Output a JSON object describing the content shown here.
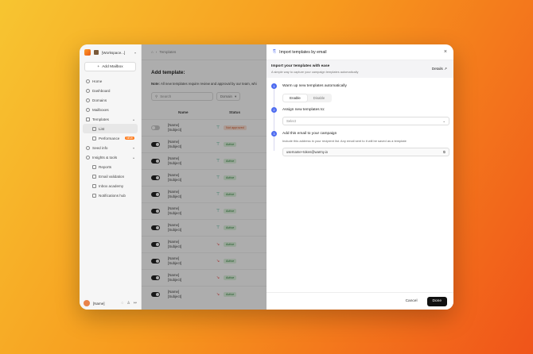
{
  "sidebar": {
    "workspace": "[Workspace...]",
    "add_mailbox": "Add Mailbox",
    "items": [
      {
        "label": "Home",
        "icon": "home-icon"
      },
      {
        "label": "Dashboard",
        "icon": "dashboard-icon"
      },
      {
        "label": "Domains",
        "icon": "globe-icon"
      },
      {
        "label": "Mailboxes",
        "icon": "mailbox-icon"
      },
      {
        "label": "Templates",
        "icon": "templates-icon"
      },
      {
        "label": "List",
        "icon": "list-icon"
      },
      {
        "label": "Performance",
        "icon": "chart-icon",
        "badge": "NEW"
      },
      {
        "label": "Seed info",
        "icon": "seed-icon"
      },
      {
        "label": "Insights & tools",
        "icon": "insights-icon"
      },
      {
        "label": "Reports",
        "icon": "report-icon"
      },
      {
        "label": "Email validation",
        "icon": "check-icon"
      },
      {
        "label": "Inbox academy",
        "icon": "academy-icon"
      },
      {
        "label": "Notifications hub",
        "icon": "bell-icon"
      }
    ],
    "user_name": "[Name]"
  },
  "main": {
    "breadcrumb_current": "Templates",
    "title": "Add template:",
    "note_bold": "Note:",
    "note_text": "All new templates require review and approval by our team, whi",
    "search_placeholder": "Search",
    "domain_filter": "Domain",
    "col_name": "Name",
    "col_status": "Status",
    "rows": [
      {
        "name": "[Name]",
        "subject": "[Subject]",
        "trend": "up",
        "status": "Not approved",
        "enabled": false
      },
      {
        "name": "[Name]",
        "subject": "[Subject]",
        "trend": "up",
        "status": "Active",
        "enabled": true
      },
      {
        "name": "[Name]",
        "subject": "[Subject]",
        "trend": "up",
        "status": "Active",
        "enabled": true
      },
      {
        "name": "[Name]",
        "subject": "[Subject]",
        "trend": "up",
        "status": "Active",
        "enabled": true
      },
      {
        "name": "[Name]",
        "subject": "[Subject]",
        "trend": "up",
        "status": "Active",
        "enabled": true
      },
      {
        "name": "[Name]",
        "subject": "[Subject]",
        "trend": "up",
        "status": "Active",
        "enabled": true
      },
      {
        "name": "[Name]",
        "subject": "[Subject]",
        "trend": "up",
        "status": "Active",
        "enabled": true
      },
      {
        "name": "[Name]",
        "subject": "[Subject]",
        "trend": "down",
        "status": "Active",
        "enabled": true
      },
      {
        "name": "[Name]",
        "subject": "[Subject]",
        "trend": "down",
        "status": "Active",
        "enabled": true
      },
      {
        "name": "[Name]",
        "subject": "[Subject]",
        "trend": "down",
        "status": "Active",
        "enabled": true
      },
      {
        "name": "[Name]",
        "subject": "[Subject]",
        "trend": "down",
        "status": "Active",
        "enabled": true
      }
    ]
  },
  "modal": {
    "title": "Import templates by email",
    "import_title": "Import your templates with ease",
    "import_sub": "A simple way to capture your campaign templates automatically",
    "details": "Details",
    "step1_num": "1",
    "step1": "Warm up new templates automatically",
    "enable": "Enable",
    "disable": "Disable",
    "step2_num": "2",
    "step2": "Assign new templates to:",
    "select_placeholder": "Select",
    "step3_num": "3",
    "step3": "Add this email to your campaign",
    "step3_desc": "Include this address in your recipient list. Any email sent to it will be saved as a template",
    "email": "username+token@warmy.io",
    "cancel": "Cancel",
    "done": "Done"
  }
}
